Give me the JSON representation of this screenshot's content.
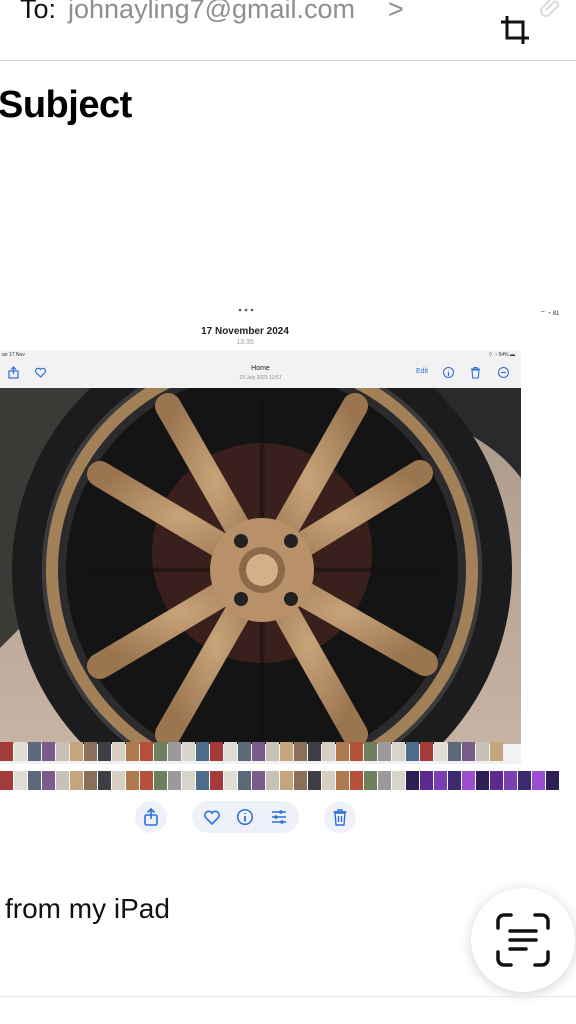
{
  "header": {
    "to_label": "To:",
    "to_value": "johnayling7@gmail.com",
    "to_chevron": ">",
    "crop_icon": "crop-icon",
    "attach_icon": "paperclip-icon"
  },
  "subject": "Subject",
  "screenshot": {
    "date": "17 November 2024",
    "time": "13:35",
    "right_status": "⌔ ◔ 81",
    "ipad": {
      "status_left": "an 17 Nov",
      "status_right": "⌔ ◔ 54% ▬",
      "title": "Home",
      "subtitle": "23 July 2023  12:57",
      "edit_label": "Edit"
    },
    "photo_subject": "bronze alloy wheel"
  },
  "toolbar": {
    "share_icon": "share-icon",
    "favorite_icon": "heart-icon",
    "info_icon": "info-icon",
    "adjust_icon": "sliders-icon",
    "delete_icon": "trash-icon"
  },
  "signature": "from my iPad",
  "scan_button_icon": "live-text-scan-icon",
  "colors": {
    "accent": "#2f6fd6",
    "muted": "#8e8e93",
    "wheel": "#b08a62"
  }
}
